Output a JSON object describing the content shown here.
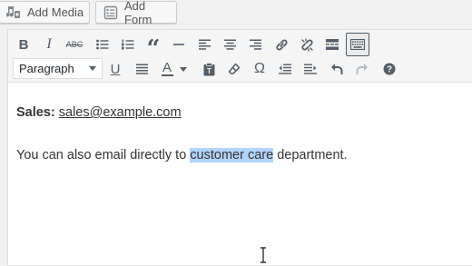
{
  "media_bar": {
    "add_media": "Add Media",
    "add_form": "Add Form",
    "add_media_icon": "camera-music-icon",
    "add_form_icon": "form-icon"
  },
  "toolbar": {
    "row1": [
      {
        "name": "bold",
        "glyph": "B"
      },
      {
        "name": "italic",
        "glyph": "I"
      },
      {
        "name": "strikethrough",
        "glyph": "ABC"
      },
      {
        "name": "bulleted-list",
        "glyph": ""
      },
      {
        "name": "numbered-list",
        "glyph": ""
      },
      {
        "name": "blockquote",
        "glyph": "“"
      },
      {
        "name": "horizontal-line",
        "glyph": ""
      },
      {
        "name": "align-left",
        "glyph": ""
      },
      {
        "name": "align-center",
        "glyph": ""
      },
      {
        "name": "align-right",
        "glyph": ""
      },
      {
        "name": "insert-link",
        "glyph": ""
      },
      {
        "name": "remove-link",
        "glyph": ""
      },
      {
        "name": "read-more",
        "glyph": ""
      },
      {
        "name": "toolbar-toggle",
        "glyph": ""
      }
    ],
    "format_select": "Paragraph",
    "row2": [
      {
        "name": "underline",
        "glyph": "U"
      },
      {
        "name": "justify",
        "glyph": ""
      },
      {
        "name": "text-color",
        "glyph": "A"
      },
      {
        "name": "paste-as-text",
        "glyph": ""
      },
      {
        "name": "clear-formatting",
        "glyph": ""
      },
      {
        "name": "special-character",
        "glyph": "Ω"
      },
      {
        "name": "decrease-indent",
        "glyph": ""
      },
      {
        "name": "increase-indent",
        "glyph": ""
      },
      {
        "name": "undo",
        "glyph": ""
      },
      {
        "name": "redo",
        "glyph": ""
      },
      {
        "name": "help",
        "glyph": "?"
      }
    ],
    "accent": "#555d66"
  },
  "content": {
    "sales_label": "Sales:",
    "sales_email": "sales@example.com",
    "line2_before": "You can also email directly to ",
    "line2_selected": "customer care",
    "line2_after": " department.",
    "selection_color": "#b3d4fd"
  }
}
